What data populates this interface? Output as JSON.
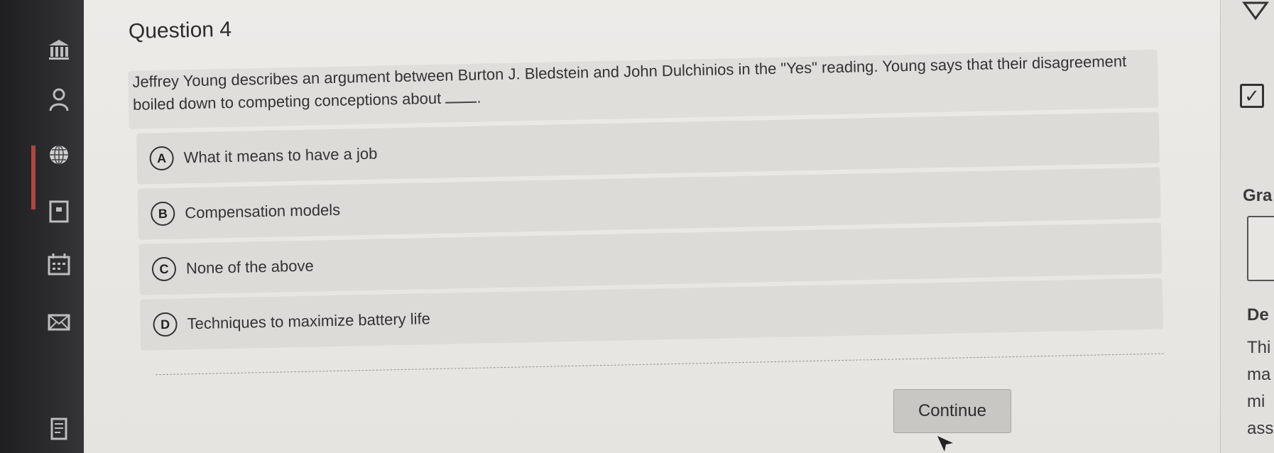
{
  "question": {
    "title": "Question 4",
    "stem_part1": "Jeffrey Young describes an argument between Burton J. Bledstein and John Dulchinios in the \"Yes\" reading. Young says that their disagreement boiled down to competing conceptions about ",
    "stem_part2": "."
  },
  "options": [
    {
      "letter": "A",
      "text": "What it means to have a job"
    },
    {
      "letter": "B",
      "text": "Compensation models"
    },
    {
      "letter": "C",
      "text": "None of the above"
    },
    {
      "letter": "D",
      "text": "Techniques to maximize battery life"
    }
  ],
  "continue_label": "Continue",
  "side_panel": {
    "heading1": "Gra",
    "heading2": "De",
    "lines": [
      "Thi",
      "ma",
      "mi",
      "ass"
    ]
  },
  "colors": {
    "rail": "#2b2b2e",
    "active_accent": "#b2453f",
    "panel": "#ecebe8",
    "option_bg": "#dcdbd8"
  },
  "icons": [
    "bank-icon",
    "user-icon",
    "globe-icon",
    "book-icon",
    "calendar-icon",
    "mail-icon",
    "notes-icon",
    "warning-icon",
    "checkbox-icon",
    "document-icon",
    "cursor-icon"
  ]
}
